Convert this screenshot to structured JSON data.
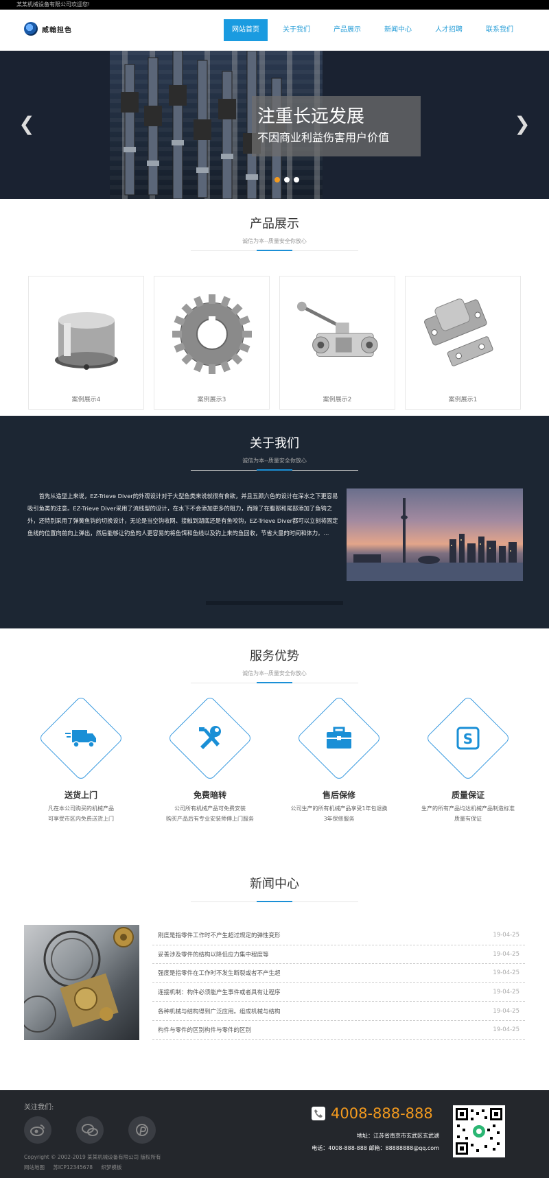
{
  "topbar": {
    "welcome": "某某机械设备有限公司欢迎您!"
  },
  "header": {
    "logo_text": "威翰担色",
    "nav": [
      {
        "label": "网站首页",
        "active": true
      },
      {
        "label": "关于我们"
      },
      {
        "label": "产品展示"
      },
      {
        "label": "新闻中心"
      },
      {
        "label": "人才招聘"
      },
      {
        "label": "联系我们"
      }
    ]
  },
  "banner": {
    "title": "注重长远发展",
    "subtitle": "不因商业利益伤害用户价值",
    "prev_icon": "chevron-left-icon",
    "next_icon": "chevron-right-icon",
    "dots": [
      {
        "active": true
      },
      {
        "active": false
      },
      {
        "active": false
      }
    ],
    "dot_active_color": "#f39a1e"
  },
  "products": {
    "title": "产品展示",
    "subtitle": "诚信为本--质量安全你放心",
    "items": [
      {
        "name": "案例展示4",
        "icon": "cap-part"
      },
      {
        "name": "案例展示3",
        "icon": "gear"
      },
      {
        "name": "案例展示2",
        "icon": "ball-valve"
      },
      {
        "name": "案例展示1",
        "icon": "latch"
      }
    ]
  },
  "about": {
    "title": "关于我们",
    "subtitle": "诚信为本--质量安全你放心",
    "text": "首先从造型上来说，EZ-Trieve Diver的外观设计对于大型鱼类来说就很有食欲，并且五颜六色的设计在深水之下更容易吸引鱼类的注意。EZ-Trieve Diver采用了流线型的设计，在水下不会添加更多的阻力，而除了在腹部和尾部添加了鱼钩之外，还特别采用了弹簧鱼钩的切换设计，无论是当空钩收网、接触到湖底还是有鱼咬钩，EZ-Trieve Diver都可以立刻将固定鱼线的位置向前向上弹出，然后能够让钓鱼的人更容易的将鱼饵和鱼线以及钓上来的鱼回收，节省大量的时间和体力。..."
  },
  "services": {
    "title": "服务优势",
    "subtitle": "诚信为本--质量安全你放心",
    "items": [
      {
        "title": "送货上门",
        "desc1": "凡在本公司购买的机械产品",
        "desc2": "可享受市区内免费送货上门",
        "icon": "truck-icon"
      },
      {
        "title": "免费暗转",
        "desc1": "公司所有机械产品可免费安装",
        "desc2": "购买产品后有专业安装师傅上门服务",
        "icon": "tools-icon"
      },
      {
        "title": "售后保修",
        "desc1": "公司生产的所有机械产品享受1年包退换",
        "desc2": "3年保修服务",
        "icon": "toolbox-icon"
      },
      {
        "title": "质量保证",
        "desc1": "生产的所有产品均达机械产品制造标准",
        "desc2": "质量有保证",
        "icon": "quality-s-icon"
      }
    ],
    "accent": "#1a8fd6"
  },
  "news": {
    "title": "新闻中心",
    "items": [
      {
        "title": "刚度是指零件工作时不产生超过规定的弹性变形",
        "date": "19-04-25"
      },
      {
        "title": "妥善涉及零件的结构以降低应力集中程度等",
        "date": "19-04-25"
      },
      {
        "title": "强度是指零件在工作时不发生断裂或者不产生超",
        "date": "19-04-25"
      },
      {
        "title": "连接机制：构件必须能产生事件或者具有让程序",
        "date": "19-04-25"
      },
      {
        "title": "各种机械与结构得到广泛应用。组成机械与结构",
        "date": "19-04-25"
      },
      {
        "title": "构件与零件的区别构件与零件的区别",
        "date": "19-04-25"
      }
    ]
  },
  "footer": {
    "follow_label": "关注我们:",
    "social": [
      "weibo-icon",
      "wechat-icon",
      "pinterest-icon"
    ],
    "copyright": "Copyright © 2002-2019 某某机械设备有限公司 版权所有",
    "links": [
      "网站地图",
      "苏ICP12345678",
      "织梦模板"
    ],
    "phone": "4008-888-888",
    "address": "地址：江苏省南京市玄武区玄武湖",
    "contact": "电话：4008-888-888 邮箱：88888888@qq.com",
    "phone_color": "#f39a1e"
  }
}
